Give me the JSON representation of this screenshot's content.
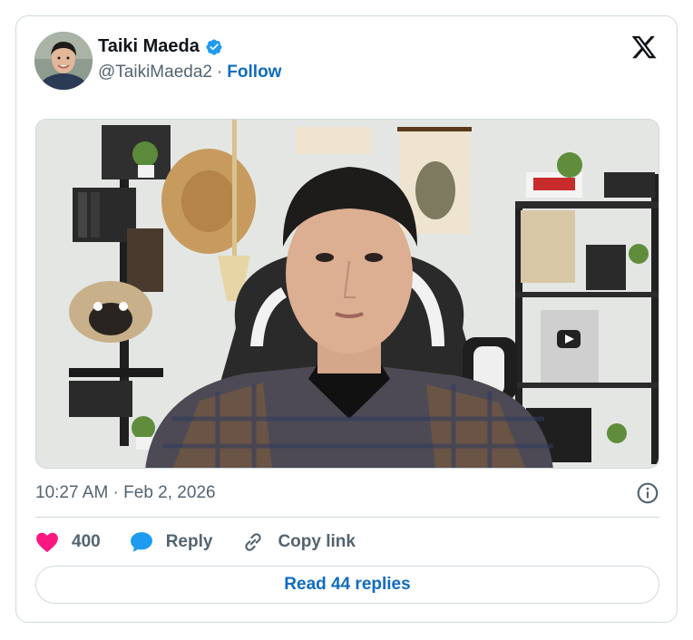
{
  "author": {
    "display_name": "Taiki Maeda",
    "handle": "@TaikiMaeda2",
    "separator": "·",
    "follow_label": "Follow",
    "verified": true
  },
  "tweet": {
    "timestamp": "10:27 AM · Feb 2, 2026"
  },
  "actions": {
    "like_count": "400",
    "reply_label": "Reply",
    "copy_link_label": "Copy link"
  },
  "read_replies_label": "Read 44 replies",
  "colors": {
    "link": "#0f6cbd",
    "verified": "#1d9bf0",
    "like": "#f91880",
    "reply": "#1d9bf0",
    "muted": "#536471",
    "border": "#cfd9de"
  },
  "icons": {
    "logo": "x-logo-icon",
    "verified": "verified-badge-icon",
    "info": "info-icon",
    "like": "heart-icon",
    "reply": "speech-bubble-icon",
    "copy_link": "link-icon"
  }
}
